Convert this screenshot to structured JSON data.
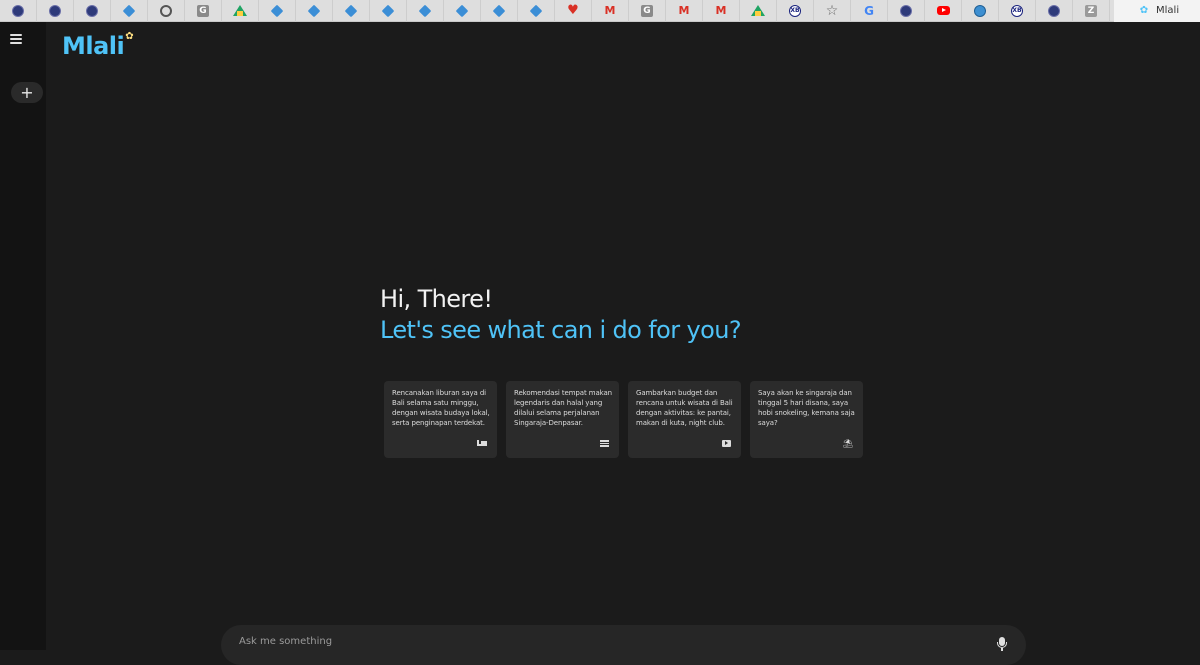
{
  "browser": {
    "tabs": [
      {
        "icon": "crest-icon",
        "glyph": ""
      },
      {
        "icon": "crest-icon",
        "glyph": ""
      },
      {
        "icon": "crest-icon",
        "glyph": ""
      },
      {
        "icon": "diamond-icon",
        "glyph": ""
      },
      {
        "icon": "gear-icon",
        "glyph": ""
      },
      {
        "icon": "g-box-icon",
        "glyph": "G"
      },
      {
        "icon": "drive-icon",
        "glyph": ""
      },
      {
        "icon": "diamond-icon",
        "glyph": ""
      },
      {
        "icon": "diamond-icon",
        "glyph": ""
      },
      {
        "icon": "diamond-icon",
        "glyph": ""
      },
      {
        "icon": "diamond-icon",
        "glyph": ""
      },
      {
        "icon": "diamond-icon",
        "glyph": ""
      },
      {
        "icon": "diamond-icon",
        "glyph": ""
      },
      {
        "icon": "diamond-icon",
        "glyph": ""
      },
      {
        "icon": "diamond-icon",
        "glyph": ""
      },
      {
        "icon": "heart-icon",
        "glyph": "♥"
      },
      {
        "icon": "gmail-icon",
        "glyph": "M"
      },
      {
        "icon": "g-box-icon",
        "glyph": "G"
      },
      {
        "icon": "gmail-icon",
        "glyph": "M"
      },
      {
        "icon": "gmail-icon",
        "glyph": "M"
      },
      {
        "icon": "drive-icon",
        "glyph": ""
      },
      {
        "icon": "xb-icon",
        "glyph": "XB"
      },
      {
        "icon": "star-icon",
        "glyph": "☆"
      },
      {
        "icon": "google-icon",
        "glyph": "G"
      },
      {
        "icon": "crest-icon",
        "glyph": ""
      },
      {
        "icon": "youtube-icon",
        "glyph": ""
      },
      {
        "icon": "globe-icon",
        "glyph": ""
      },
      {
        "icon": "xb-icon",
        "glyph": "XB"
      },
      {
        "icon": "crest-icon",
        "glyph": ""
      },
      {
        "icon": "z-box-icon",
        "glyph": "Z"
      }
    ],
    "active_tab": {
      "title": "Mlali",
      "icon": "mlali-icon",
      "glyph": "✿"
    }
  },
  "sidebar": {
    "menu_icon": "menu-icon",
    "new_chat_label": "+"
  },
  "header": {
    "logo": "Mlali",
    "logo_flower": "✿"
  },
  "greeting": {
    "line1": "Hi, There!",
    "line2": "Let's see what can i do for you?"
  },
  "suggestions": [
    {
      "text": "Rencanakan liburan saya di Bali selama satu minggu, dengan wisata budaya lokal, serta penginapan terdekat.",
      "icon": "bed-icon"
    },
    {
      "text": "Rekomendasi tempat makan legendaris dan halal yang dilalui selama perjalanan Singaraja-Denpasar.",
      "icon": "checklist-icon"
    },
    {
      "text": "Gambarkan budget dan rencana untuk wisata di Bali dengan aktivitas: ke pantai, makan di kuta, night club.",
      "icon": "video-icon"
    },
    {
      "text": "Saya akan ke singaraja dan tinggal 5 hari disana, saya hobi snokeling, kemana saja saya?",
      "icon": "beach-umbrella-icon"
    }
  ],
  "prompt": {
    "placeholder": "Ask me something",
    "value": "",
    "mic_icon": "microphone-icon"
  },
  "colors": {
    "background": "#1b1b1b",
    "rail": "#131313",
    "card": "#2b2b2b",
    "accent": "#4fc3f7",
    "text": "#f2f2f2"
  }
}
